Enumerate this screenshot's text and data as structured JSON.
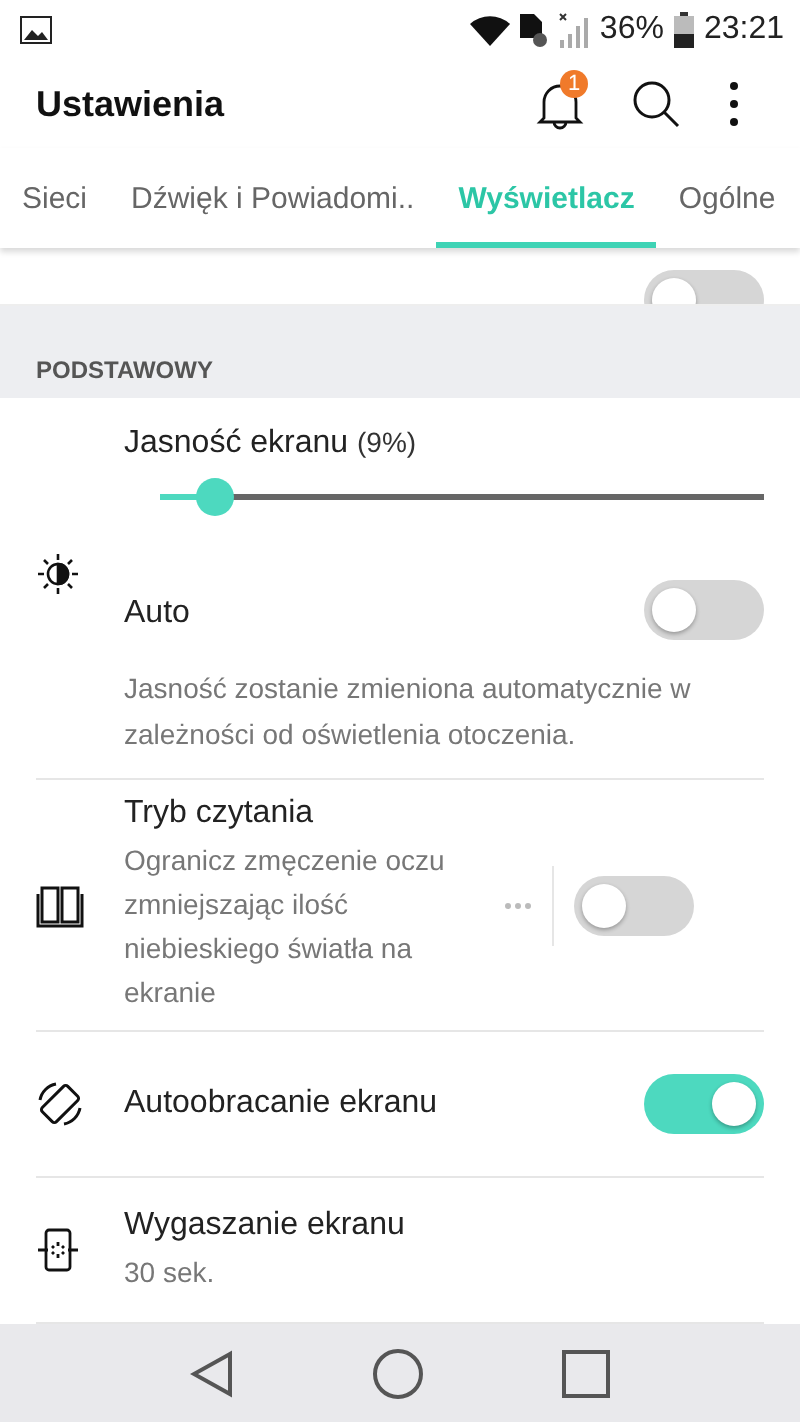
{
  "status_bar": {
    "battery_percent": "36%",
    "time": "23:21"
  },
  "app_bar": {
    "title": "Ustawienia",
    "notification_count": "1"
  },
  "tabs": [
    {
      "label": "Sieci",
      "selected": false
    },
    {
      "label": "Dźwięk i Powiadomi..",
      "selected": false
    },
    {
      "label": "Wyświetlacz",
      "selected": true
    },
    {
      "label": "Ogólne",
      "selected": false
    }
  ],
  "partial_row": {
    "on": false
  },
  "section": {
    "header": "PODSTAWOWY"
  },
  "brightness": {
    "label": "Jasność ekranu",
    "reading": "(9%)",
    "level": 0.09
  },
  "items": [
    {
      "kind": "toggle",
      "title": "Auto",
      "description": "Jasność zostanie zmieniona automatycznie w zależności od oświetlenia otoczenia.",
      "on": false
    },
    {
      "kind": "toggle-more",
      "title": "Tryb czytania",
      "subtitle": "Ogranicz zmęczenie oczu zmniejszając ilość niebieskiego światła na ekranie",
      "on": false
    },
    {
      "kind": "toggle",
      "title": "Autoobracanie ekranu",
      "on": true
    },
    {
      "kind": "value",
      "title": "Wygaszanie ekranu",
      "subtitle": "30 sek."
    }
  ]
}
